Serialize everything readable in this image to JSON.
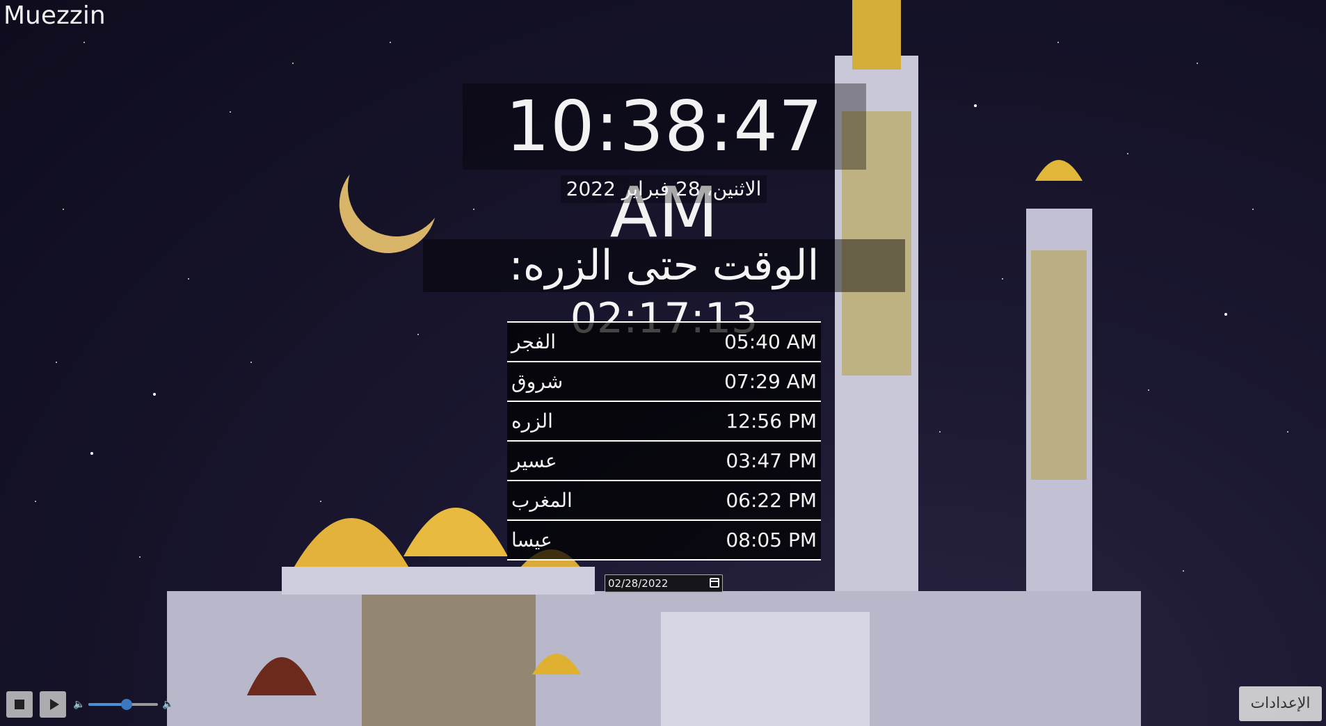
{
  "app": {
    "title": "Muezzin"
  },
  "clock": {
    "time": "10:38:47 AM",
    "date": "الاثنين، 28 فبراير 2022"
  },
  "countdown": {
    "text": "الوقت حتى الزره: 02:17:13"
  },
  "prayers": [
    {
      "name": "الفجر",
      "time": "05:40 AM"
    },
    {
      "name": "شروق",
      "time": "07:29 AM"
    },
    {
      "name": "الزره",
      "time": "12:56 PM"
    },
    {
      "name": "عسير",
      "time": "03:47 PM"
    },
    {
      "name": "المغرب",
      "time": "06:22 PM"
    },
    {
      "name": "عيسا",
      "time": "08:05 PM"
    }
  ],
  "date_picker": {
    "value": "02/28/2022"
  },
  "player": {
    "volume": 0.55,
    "accent": "#4a90d9"
  },
  "settings": {
    "label": "الإعدادات"
  }
}
